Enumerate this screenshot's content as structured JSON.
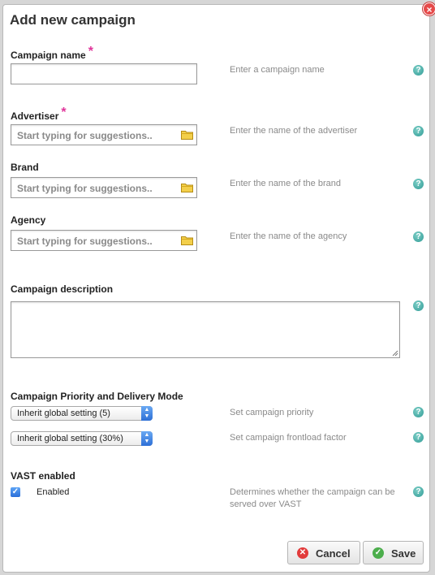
{
  "dialog": {
    "title": "Add new campaign",
    "close_symbol": "×"
  },
  "fields": {
    "campaign_name": {
      "label": "Campaign name",
      "required_mark": "*",
      "value": "",
      "hint": "Enter a campaign name"
    },
    "advertiser": {
      "label": "Advertiser",
      "required_mark": "*",
      "placeholder": "Start typing for suggestions..",
      "hint": "Enter the name of the advertiser",
      "icon": "folder-icon"
    },
    "brand": {
      "label": "Brand",
      "placeholder": "Start typing for suggestions..",
      "hint": "Enter the name of the brand",
      "icon": "folder-icon"
    },
    "agency": {
      "label": "Agency",
      "placeholder": "Start typing for suggestions..",
      "hint": "Enter the name of the agency",
      "icon": "folder-icon"
    },
    "description": {
      "label": "Campaign description",
      "value": ""
    },
    "priority_section": {
      "label": "Campaign Priority and Delivery Mode",
      "priority_selected": "Inherit global setting (5)",
      "priority_hint": "Set campaign priority",
      "frontload_selected": "Inherit global setting (30%)",
      "frontload_hint": "Set campaign frontload factor"
    },
    "vast": {
      "label": "VAST enabled",
      "checkbox_label": "Enabled",
      "checked": true,
      "hint": "Determines whether the campaign can be served over VAST"
    }
  },
  "help_symbol": "?",
  "check_symbol": "✓",
  "buttons": {
    "cancel": "Cancel",
    "save": "Save"
  },
  "colors": {
    "required": "#e0359a",
    "help": "#2f9a95",
    "cancel_icon": "#e23b3b",
    "save_icon": "#4cae4c",
    "checkbox": "#2a6ed8"
  }
}
